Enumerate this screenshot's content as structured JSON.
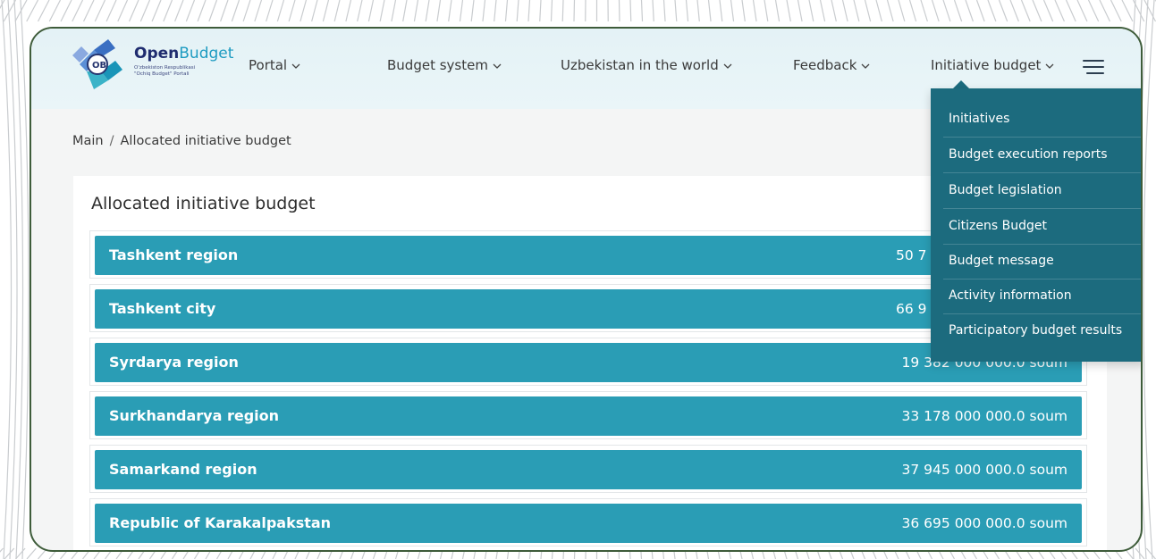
{
  "brand": {
    "name_bold": "Open",
    "name_light": "Budget",
    "subtitle_line1": "O'zbekiston Respublikasi",
    "subtitle_line2": "\"Ochiq Budget\" Portali",
    "logo_letters": "OB"
  },
  "nav": {
    "items": [
      {
        "label": "Portal"
      },
      {
        "label": "Budget system"
      },
      {
        "label": "Uzbekistan in the world"
      },
      {
        "label": "Feedback"
      },
      {
        "label": "Initiative budget"
      }
    ]
  },
  "dropdown": {
    "items": [
      {
        "label": "Initiatives"
      },
      {
        "label": "Budget execution reports"
      },
      {
        "label": "Budget legislation"
      },
      {
        "label": "Citizens Budget"
      },
      {
        "label": "Budget message"
      },
      {
        "label": "Activity information"
      },
      {
        "label": "Participatory budget results"
      }
    ]
  },
  "breadcrumb": {
    "home": "Main",
    "separator": "/",
    "current": "Allocated initiative budget"
  },
  "main": {
    "title": "Allocated initiative budget",
    "regions": [
      {
        "name": "Tashkent region",
        "amount": "50 7"
      },
      {
        "name": "Tashkent city",
        "amount": "66 9"
      },
      {
        "name": "Syrdarya region",
        "amount": "19 382 000 000.0 soum"
      },
      {
        "name": "Surkhandarya region",
        "amount": "33 178 000 000.0 soum"
      },
      {
        "name": "Samarkand region",
        "amount": "37 945 000 000.0 soum"
      },
      {
        "name": "Republic of Karakalpakstan",
        "amount": "36 695 000 000.0 soum"
      }
    ]
  },
  "colors": {
    "header_bg": "#e4f2f6",
    "row_bar": "#2a9db5",
    "dropdown_bg": "#1c6b7e",
    "frame_border": "#3e5c3a"
  },
  "icons": {
    "menu": "hamburger-icon",
    "chevron": "chevron-down-icon",
    "logo": "openbudget-logo"
  }
}
